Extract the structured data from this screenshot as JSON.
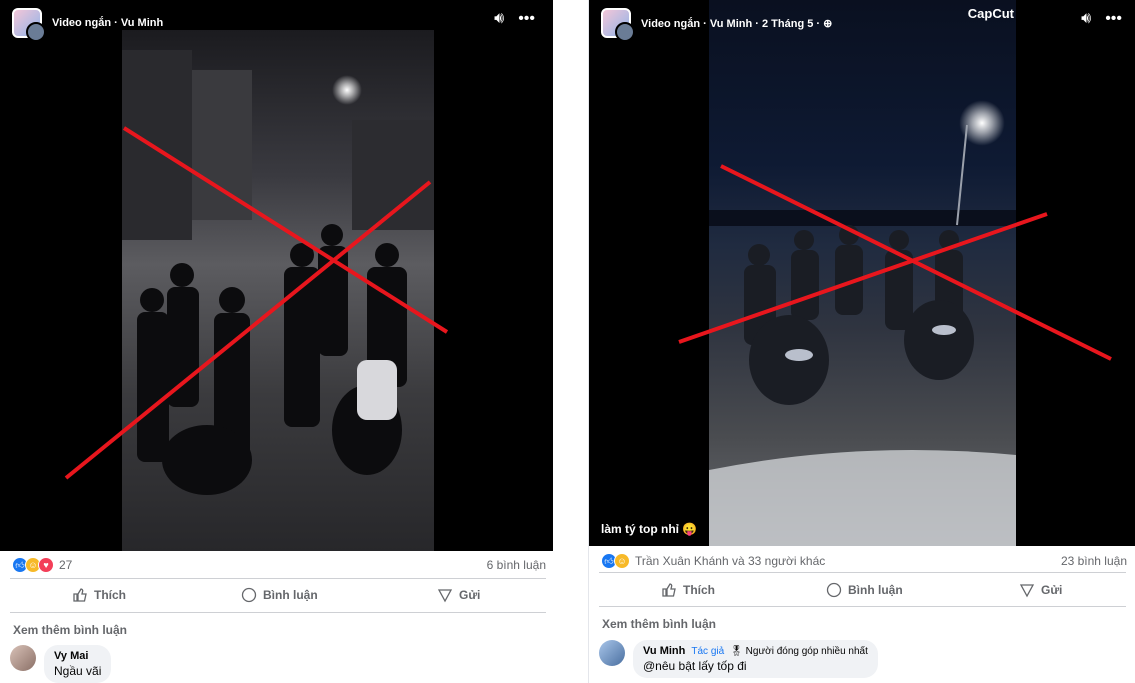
{
  "left_post": {
    "header": {
      "title": "Video ngắn · Vu Minh"
    },
    "reactions": {
      "count": "27",
      "comments_count": "6 bình luận"
    },
    "actions": {
      "like": "Thích",
      "comment": "Bình luận",
      "share": "Gửi"
    },
    "more_comments": "Xem thêm bình luận",
    "comment": {
      "author": "Vy Mai",
      "text": "Ngầu vãi"
    }
  },
  "right_post": {
    "header": {
      "title": "Video ngắn · Vu Minh · 2 Tháng 5 · ⊕"
    },
    "watermark": "CapCut",
    "caption": "làm tý top nhỉ 😛",
    "reactions": {
      "names": "Trần Xuân Khánh và 33 người khác",
      "comments_count": "23 bình luận"
    },
    "actions": {
      "like": "Thích",
      "comment": "Bình luận",
      "share": "Gửi"
    },
    "more_comments": "Xem thêm bình luận",
    "comment": {
      "author": "Vu Minh",
      "author_badge": "Tác giả",
      "top_badge": "Người đóng góp nhiều nhất",
      "text": "@nêu bật lấy tốp đi"
    }
  },
  "colors": {
    "red_x": "#e8161d",
    "accent_blue": "#1877f2",
    "muted_text": "#65676b"
  },
  "icons": [
    "volume-icon",
    "more-icon",
    "like-icon",
    "comment-icon",
    "share-icon",
    "like-reaction-icon",
    "haha-reaction-icon",
    "love-reaction-icon"
  ]
}
